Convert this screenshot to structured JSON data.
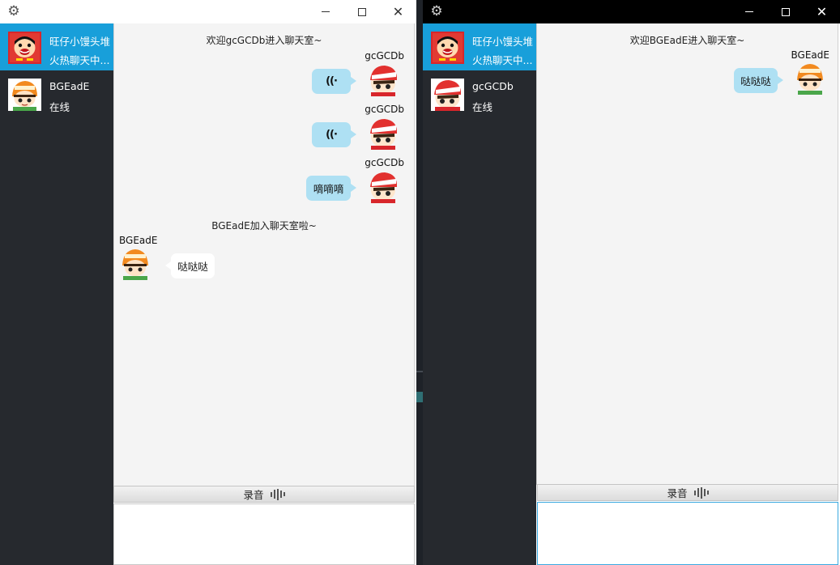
{
  "windows": [
    {
      "id": "win1",
      "contacts": [
        {
          "name": "旺仔小馒头堆",
          "status": "火热聊天中...",
          "active": true
        },
        {
          "name": "BGEadE",
          "status": "在线",
          "active": false
        }
      ],
      "messages": {
        "system_welcome": "欢迎gcGCDb进入聊天室~",
        "sender_me_1": "gcGCDb",
        "sender_me_2": "gcGCDb",
        "sender_me_3": "gcGCDb",
        "voice_1": "((·",
        "voice_2": "((·",
        "text_me": "嘀嘀嘀",
        "system_join": "BGEadE加入聊天室啦~",
        "sender_other": "BGEadE",
        "text_other": "哒哒哒"
      },
      "record_label": "录音"
    },
    {
      "id": "win2",
      "contacts": [
        {
          "name": "旺仔小馒头堆",
          "status": "火热聊天中...",
          "active": true
        },
        {
          "name": "gcGCDb",
          "status": "在线",
          "active": false
        }
      ],
      "messages": {
        "system_welcome": "欢迎BGEadE进入聊天室~",
        "sender_me": "BGEadE",
        "text_me": "哒哒哒"
      },
      "record_label": "录音"
    }
  ],
  "icons": {
    "settings": "gear-icon",
    "minimize": "minimize-icon",
    "maximize": "maximize-icon",
    "close": "close-icon",
    "record": "sound-wave-icon",
    "voice_message": "voice-playback-icon"
  },
  "colors": {
    "active_contact": "#189fda",
    "sidebar": "#26292e",
    "my_bubble": "#aee0f3",
    "their_bubble": "#ffffff",
    "chat_background": "#f4f4f4",
    "input_focus": "#3aa9e0"
  }
}
